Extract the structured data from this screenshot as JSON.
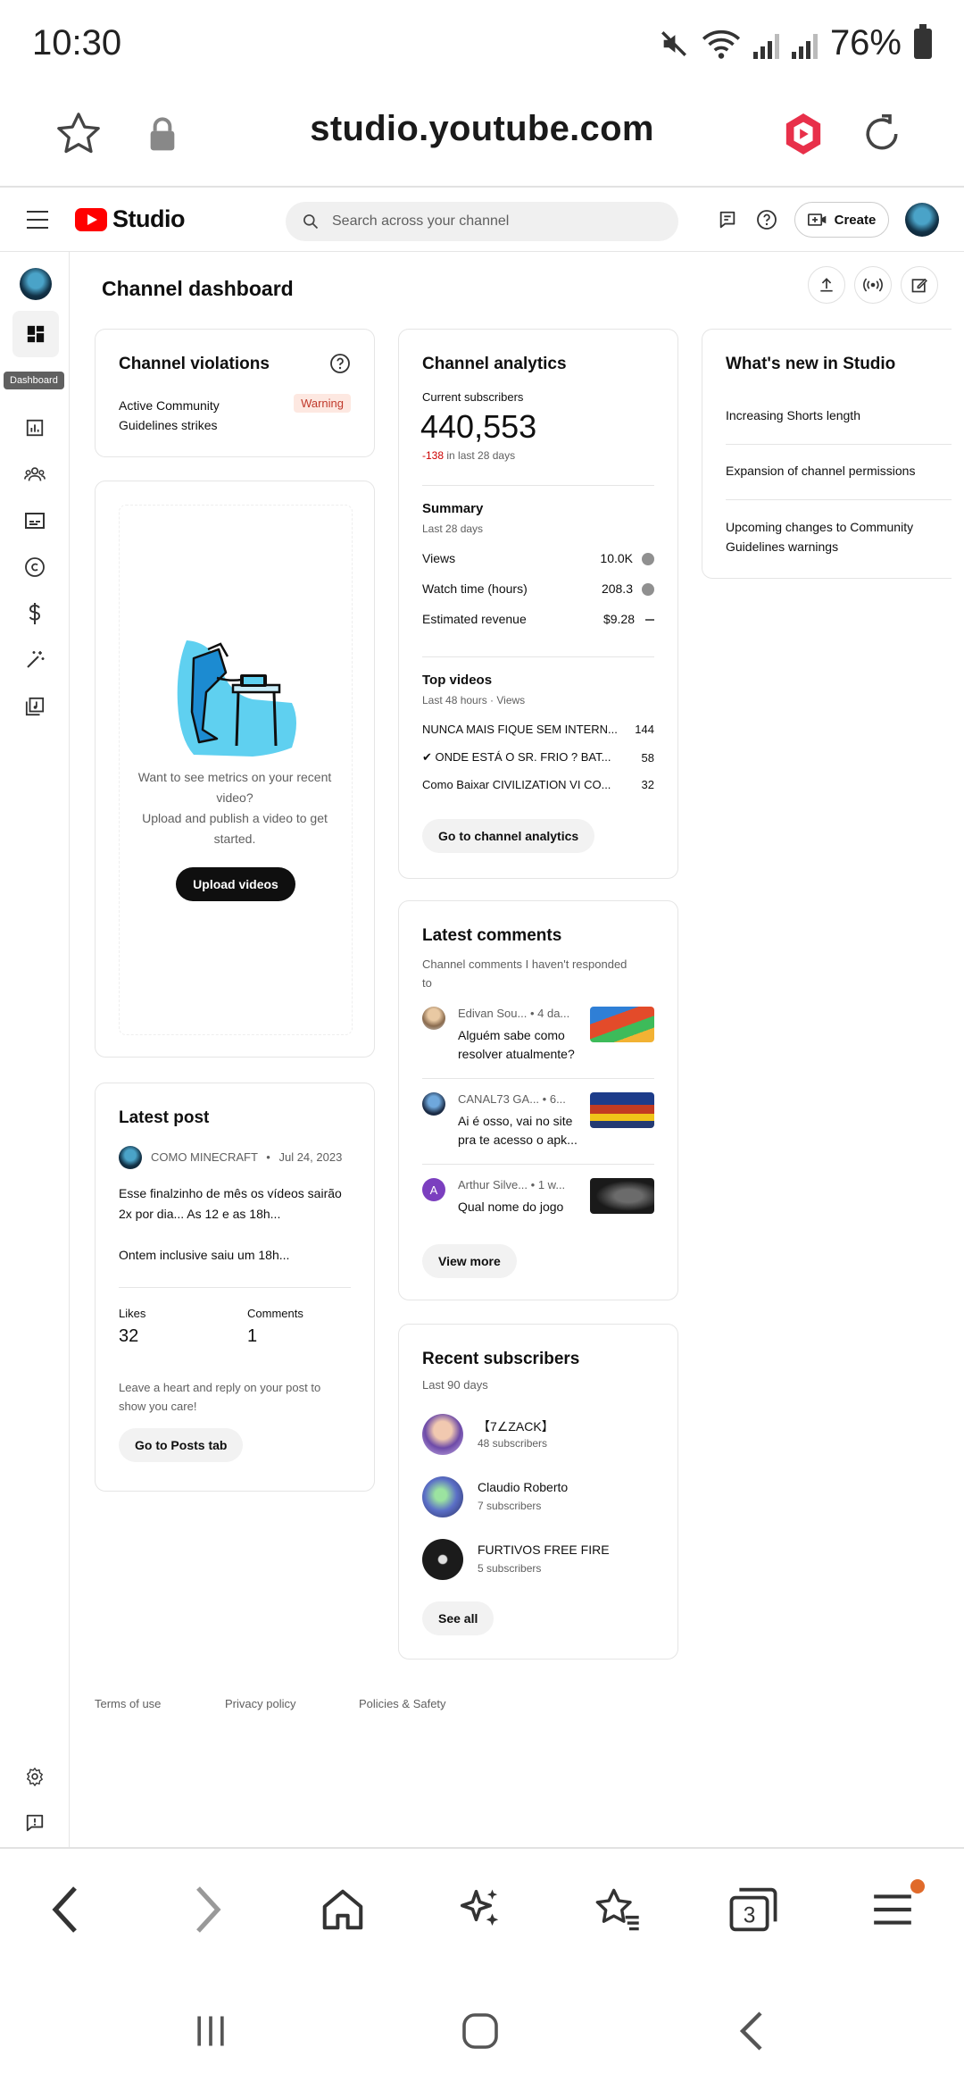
{
  "status": {
    "time": "10:30",
    "battery": "76%"
  },
  "browser": {
    "url": "studio.youtube.com",
    "tab_count": "3"
  },
  "header": {
    "logo_text": "Studio",
    "search_placeholder": "Search across your channel",
    "create_label": "Create"
  },
  "nav": {
    "tooltip": "Dashboard"
  },
  "page": {
    "title": "Channel dashboard"
  },
  "violations": {
    "title": "Channel violations",
    "label_line1": "Active Community",
    "label_line2": "Guidelines strikes",
    "badge": "Warning"
  },
  "upload": {
    "text_line1": "Want to see metrics on your recent",
    "text_line2": "video?",
    "text_line3": "Upload and publish a video to get",
    "text_line4": "started.",
    "button": "Upload videos"
  },
  "latest_post": {
    "title": "Latest post",
    "channel": "COMO MINECRAFT",
    "date": "Jul 24, 2023",
    "text_line1": "Esse finalzinho de mês os vídeos sairão",
    "text_line2": "2x por dia... As 12 e as 18h...",
    "text_line3": "Ontem inclusive saiu um 18h...",
    "likes_label": "Likes",
    "likes_value": "32",
    "comments_label": "Comments",
    "comments_value": "1",
    "cta_line1": "Leave a heart and reply on your post to",
    "cta_line2": "show you care!",
    "button": "Go to Posts tab"
  },
  "analytics": {
    "title": "Channel analytics",
    "subs_label": "Current subscribers",
    "subs_value": "440,553",
    "subs_delta": "-138",
    "subs_period": " in last 28 days",
    "summary_title": "Summary",
    "summary_period": "Last 28 days",
    "metrics": [
      {
        "label": "Views",
        "value": "10.0K"
      },
      {
        "label": "Watch time (hours)",
        "value": "208.3"
      },
      {
        "label": "Estimated revenue",
        "value": "$9.28"
      }
    ],
    "top_title": "Top videos",
    "top_period": "Last 48 hours · Views",
    "videos": [
      {
        "title": "NUNCA MAIS FIQUE SEM INTERN...",
        "views": "144"
      },
      {
        "title": "✔ ONDE ESTÁ O SR. FRIO ? BAT...",
        "views": "58"
      },
      {
        "title": "Como Baixar CIVILIZATION VI CO...",
        "views": "32"
      }
    ],
    "button": "Go to channel analytics"
  },
  "comments": {
    "title": "Latest comments",
    "sub_line1": "Channel comments I haven't responded",
    "sub_line2": "to",
    "items": [
      {
        "author": "Edivan Sou...",
        "age": "• 4 da...",
        "text_line1": "Alguém sabe como",
        "text_line2": "resolver atualmente?"
      },
      {
        "author": "CANAL73 GA...",
        "age": "• 6...",
        "text_line1": "Ai é osso, vai no site",
        "text_line2": "pra te acesso o apk..."
      },
      {
        "author": "Arthur Silve...",
        "age": "• 1 w...",
        "text_line1": "Qual nome do jogo",
        "text_line2": "",
        "initial": "A"
      }
    ],
    "button": "View more"
  },
  "subscribers": {
    "title": "Recent subscribers",
    "period": "Last 90 days",
    "items": [
      {
        "name": "【7∠ZACK】",
        "count": "48 subscribers"
      },
      {
        "name": "Claudio Roberto",
        "count": "7 subscribers"
      },
      {
        "name": "FURTIVOS FREE FIRE",
        "count": "5 subscribers"
      }
    ],
    "button": "See all"
  },
  "whats_new": {
    "title": "What's new in Studio",
    "items": [
      {
        "line1": "Increasing Shorts length",
        "line2": ""
      },
      {
        "line1": "Expansion of channel permissions",
        "line2": ""
      },
      {
        "line1": "Upcoming changes to Community",
        "line2": "Guidelines warnings"
      }
    ]
  },
  "footer": {
    "terms": "Terms of use",
    "privacy": "Privacy policy",
    "policies": "Policies & Safety"
  },
  "colors": {
    "brand_red": "#ff0000",
    "warning_bg": "#fde8e1",
    "warning_text": "#c0392b",
    "delta_red": "#cc0000",
    "browser_accent": "#e8304a"
  }
}
